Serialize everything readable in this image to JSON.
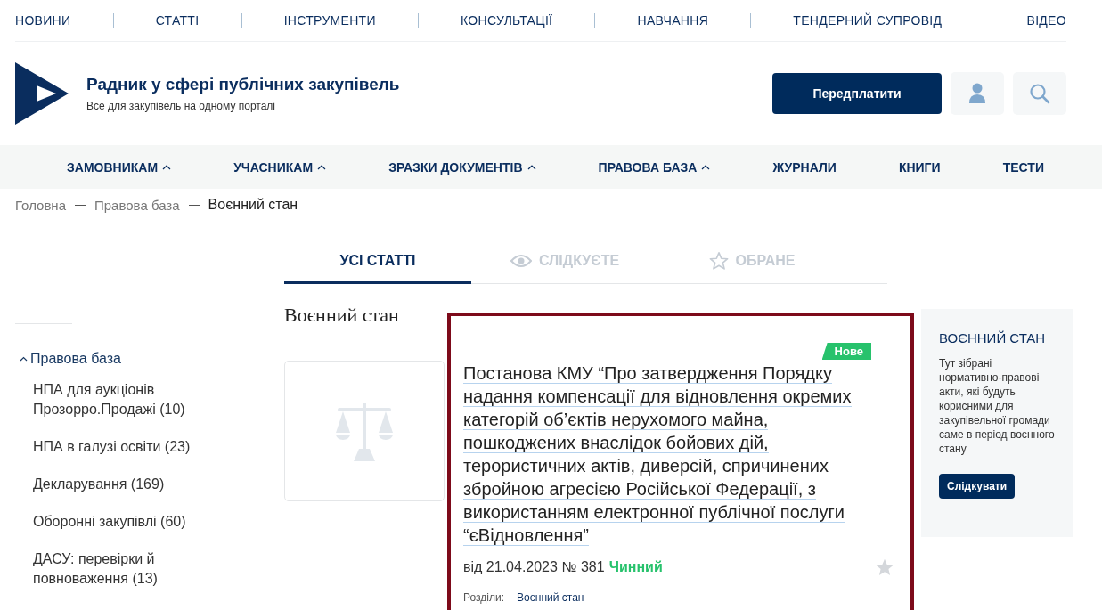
{
  "top_nav": [
    "НОВИНИ",
    "СТАТТІ",
    "ІНСТРУМЕНТИ",
    "КОНСУЛЬТАЦІЇ",
    "НАВЧАННЯ",
    "ТЕНДЕРНИЙ СУПРОВІД",
    "ВІДЕО"
  ],
  "header": {
    "title": "Радник у сфері публічних закупівель",
    "subtitle": "Все для закупівель на одному порталі",
    "subscribe": "Передплатити"
  },
  "main_menu": [
    {
      "label": "ЗАМОВНИКАМ",
      "dropdown": true
    },
    {
      "label": "УЧАСНИКАМ",
      "dropdown": true
    },
    {
      "label": "ЗРАЗКИ ДОКУМЕНТІВ",
      "dropdown": true
    },
    {
      "label": "ПРАВОВА БАЗА",
      "dropdown": true
    },
    {
      "label": "ЖУРНАЛИ",
      "dropdown": false
    },
    {
      "label": "КНИГИ",
      "dropdown": false
    },
    {
      "label": "ТЕСТИ",
      "dropdown": false
    }
  ],
  "breadcrumb": [
    "Головна",
    "Правова база",
    "Воєнний стан"
  ],
  "tabs": [
    {
      "label": "УСІ СТАТТІ",
      "selected": true,
      "kind": "all"
    },
    {
      "label": "СЛІДКУЄТЕ",
      "selected": false,
      "kind": "follow"
    },
    {
      "label": "ОБРАНЕ",
      "selected": false,
      "kind": "favorite"
    }
  ],
  "sidebar": {
    "items": [
      {
        "label": "Правова база",
        "expanded": true,
        "children": [
          {
            "label": "НПА для аукціонів Прозорро.Продажі (10)"
          },
          {
            "label": "НПА в галузі освіти (23)"
          },
          {
            "label": "Декларування (169)"
          },
          {
            "label": "Оборонні закупівлі (60)"
          },
          {
            "label": "ДАСУ: перевірки й повноваження (13)"
          }
        ]
      }
    ]
  },
  "page_title": "Воєнний стан",
  "articles": [
    {
      "badge": "Нове",
      "title": "Постанова КМУ “Про затвердження Порядку надання компенсації для відновлення окремих категорій об’єктів нерухомого майна, пошкоджених внаслідок бойових дій, терористичних актів, диверсій, спричинених збройною агресією Російської Федерації, з використанням електронної публічної послуги “єВідновлення”",
      "meta": "від 21.04.2023 № 381",
      "status": "Чинний",
      "favorite": false,
      "highlighted": true,
      "sections_label": "Розділи:",
      "sections": [
        "Воєнний стан"
      ]
    }
  ],
  "info_panel": {
    "title": "ВОЄННИЙ СТАН",
    "text": "Тут зібрані нормативно-правові акти, які будуть корисними для закупівельної громади саме в період воєнного стану",
    "button": "Слідкувати"
  }
}
